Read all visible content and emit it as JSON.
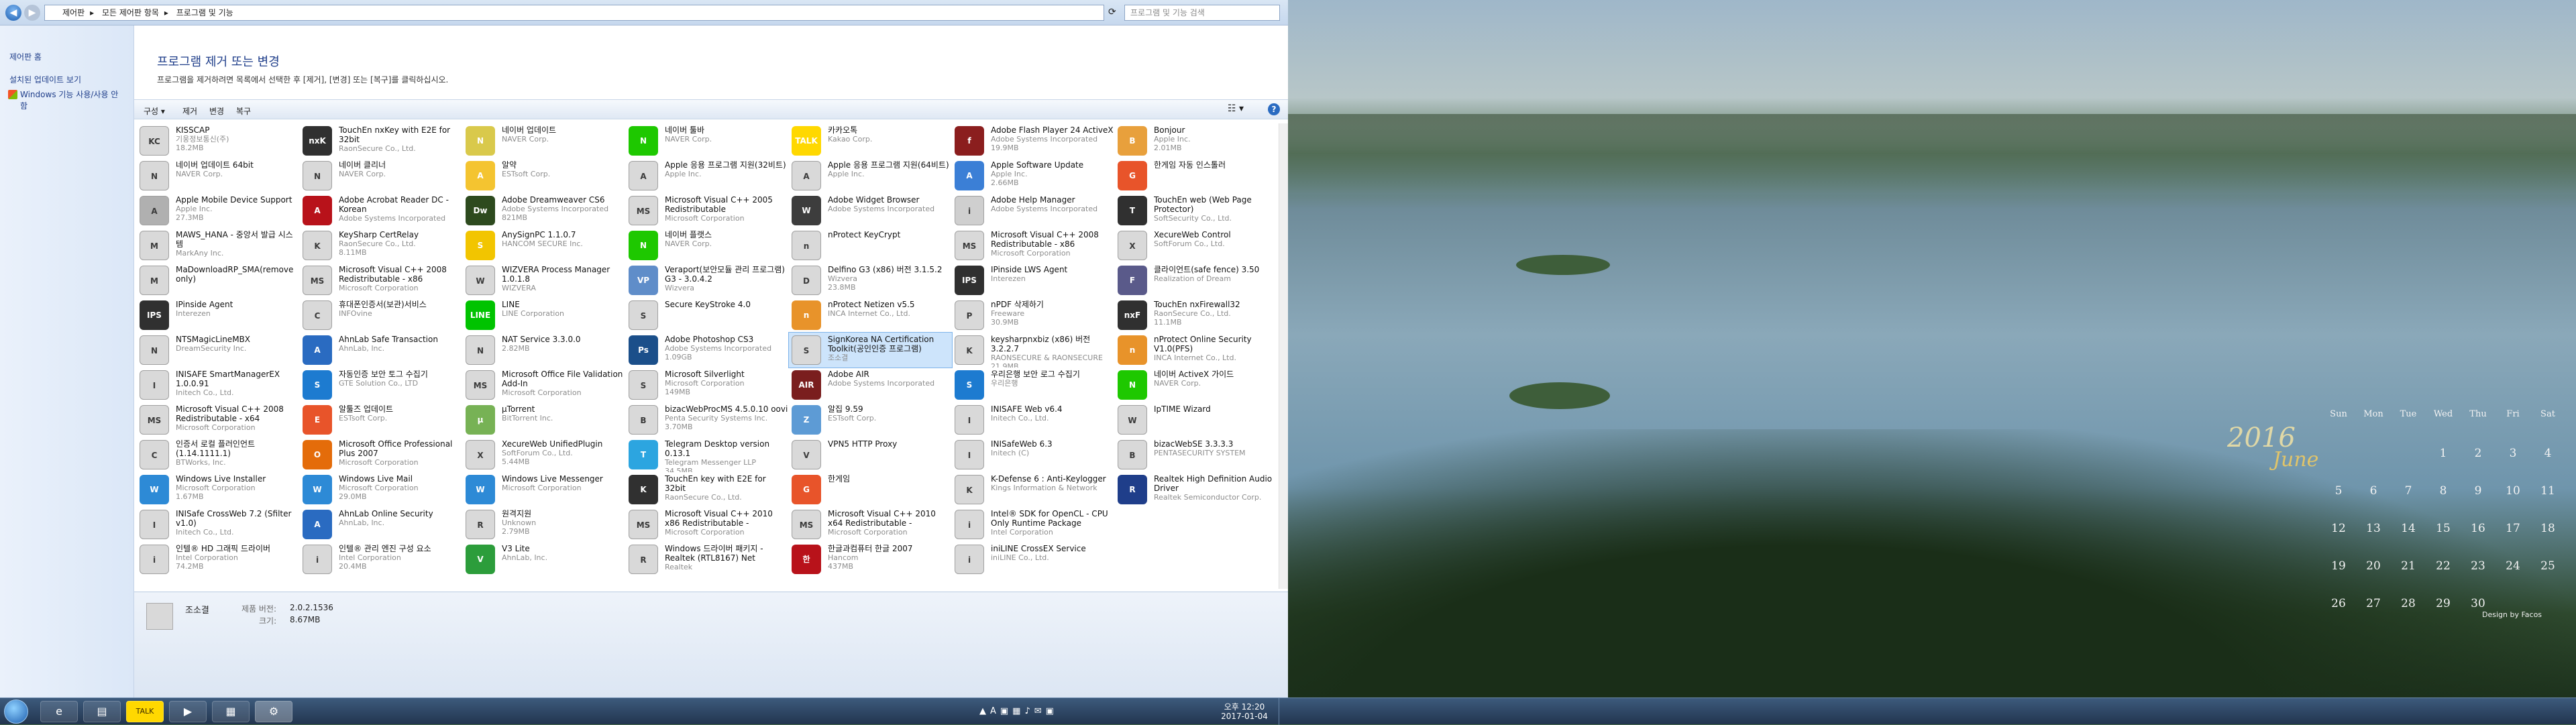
{
  "window": {
    "breadcrumb": [
      "제어판",
      "모든 제어판 항목",
      "프로그램 및 기능"
    ],
    "search_placeholder": "프로그램 및 기능 검색"
  },
  "sidebar": {
    "links": [
      "제어판 홈",
      "설치된 업데이트 보기",
      "Windows 기능 사용/사용 안 함"
    ]
  },
  "main": {
    "title": "프로그램 제거 또는 변경",
    "description": "프로그램을 제거하려면 목록에서 선택한 후 [제거], [변경] 또는 [복구]를 클릭하십시오."
  },
  "toolbar": {
    "organize": "구성 ▾",
    "uninstall": "제거",
    "change": "변경",
    "repair": "복구"
  },
  "programs": [
    {
      "name": "KISSCAP",
      "publisher": "기웅정보통신(주)",
      "size": "18.2MB",
      "color": "#d9d9d9",
      "icon": "KC"
    },
    {
      "name": "네이버 업데이트 64bit",
      "publisher": "NAVER Corp.",
      "size": "",
      "color": "#d9d9d9",
      "icon": "N"
    },
    {
      "name": "Apple Mobile Device Support",
      "publisher": "Apple Inc.",
      "size": "27.3MB",
      "color": "#b0b0b0",
      "icon": "A"
    },
    {
      "name": "MAWS_HANA - 중앙서 발급 시스템",
      "publisher": "MarkAny Inc.",
      "size": "",
      "color": "#d9d9d9",
      "icon": "M"
    },
    {
      "name": "MaDownloadRP_SMA(remove only)",
      "publisher": "",
      "size": "",
      "color": "#d9d9d9",
      "icon": "M"
    },
    {
      "name": "IPinside Agent",
      "publisher": "Interezen",
      "size": "",
      "color": "#303030",
      "icon": "IPS"
    },
    {
      "name": "NTSMagicLineMBX",
      "publisher": "DreamSecurity Inc.",
      "size": "",
      "color": "#d9d9d9",
      "icon": "N"
    },
    {
      "name": "INISAFE SmartManagerEX 1.0.0.91",
      "publisher": "Initech Co., Ltd.",
      "size": "",
      "color": "#d9d9d9",
      "icon": "I"
    },
    {
      "name": "Microsoft Visual C++ 2008 Redistributable - x64 9.0.3072...",
      "publisher": "Microsoft Corporation",
      "size": "",
      "color": "#d9d9d9",
      "icon": "MS"
    },
    {
      "name": "인증서 로컬 플러인언트 (1.14.1111.1)",
      "publisher": "BTWorks, Inc.",
      "size": "",
      "color": "#d9d9d9",
      "icon": "C"
    },
    {
      "name": "Windows Live Installer",
      "publisher": "Microsoft Corporation",
      "size": "1.67MB",
      "color": "#2d8ad6",
      "icon": "W"
    },
    {
      "name": "INISafe CrossWeb 7.2 (Sfilter v1.0)",
      "publisher": "Initech Co., Ltd.",
      "size": "",
      "color": "#d9d9d9",
      "icon": "I"
    },
    {
      "name": "인텔® HD 그래픽 드라이버",
      "publisher": "Intel Corporation",
      "size": "74.2MB",
      "color": "#d9d9d9",
      "icon": "i"
    },
    {
      "name": "TouchEn nxKey with E2E for 32bit",
      "publisher": "RaonSecure Co., Ltd.",
      "size": "",
      "color": "#303030",
      "icon": "nxK"
    },
    {
      "name": "네이버 클리너",
      "publisher": "NAVER Corp.",
      "size": "",
      "color": "#d9d9d9",
      "icon": "N"
    },
    {
      "name": "Adobe Acrobat Reader DC - Korean",
      "publisher": "Adobe Systems Incorporated",
      "size": "",
      "color": "#b8121a",
      "icon": "A"
    },
    {
      "name": "KeySharp CertRelay",
      "publisher": "RaonSecure Co., Ltd.",
      "size": "8.11MB",
      "color": "#d9d9d9",
      "icon": "K"
    },
    {
      "name": "Microsoft Visual C++ 2008 Redistributable - x86 9.0.21022",
      "publisher": "Microsoft Corporation",
      "size": "",
      "color": "#d9d9d9",
      "icon": "MS"
    },
    {
      "name": "휴대폰인증서(보관)서비스",
      "publisher": "INFOvine",
      "size": "",
      "color": "#d9d9d9",
      "icon": "C"
    },
    {
      "name": "AhnLab Safe Transaction",
      "publisher": "AhnLab, Inc.",
      "size": "",
      "color": "#2a6bc1",
      "icon": "A"
    },
    {
      "name": "자동인증 보안 토그 수집기",
      "publisher": "GTE Solution Co., LTD",
      "size": "",
      "color": "#1d7bd0",
      "icon": "S"
    },
    {
      "name": "알툴즈 업데이트",
      "publisher": "ESTsoft Corp.",
      "size": "",
      "color": "#e8542a",
      "icon": "E"
    },
    {
      "name": "Microsoft Office Professional Plus 2007",
      "publisher": "Microsoft Corporation",
      "size": "",
      "color": "#e46c0a",
      "icon": "O"
    },
    {
      "name": "Windows Live Mail",
      "publisher": "Microsoft Corporation",
      "size": "29.0MB",
      "color": "#2d8ad6",
      "icon": "W"
    },
    {
      "name": "AhnLab Online Security",
      "publisher": "AhnLab, Inc.",
      "size": "",
      "color": "#2a6bc1",
      "icon": "A"
    },
    {
      "name": "인텔® 관리 엔진 구성 요소",
      "publisher": "Intel Corporation",
      "size": "20.4MB",
      "color": "#d9d9d9",
      "icon": "i"
    },
    {
      "name": "네이버 업데이트",
      "publisher": "NAVER Corp.",
      "size": "",
      "color": "#d9c94b",
      "icon": "N"
    },
    {
      "name": "알약",
      "publisher": "ESTsoft Corp.",
      "size": "",
      "color": "#f4c430",
      "icon": "A"
    },
    {
      "name": "Adobe Dreamweaver CS6",
      "publisher": "Adobe Systems Incorporated",
      "size": "821MB",
      "color": "#2d4a1e",
      "icon": "Dw"
    },
    {
      "name": "AnySignPC 1.1.0.7",
      "publisher": "HANCOM SECURE Inc.",
      "size": "",
      "color": "#f2c500",
      "icon": "S"
    },
    {
      "name": "WIZVERA Process Manager 1.0.1.8",
      "publisher": "WIZVERA",
      "size": "",
      "color": "#d9d9d9",
      "icon": "W"
    },
    {
      "name": "LINE",
      "publisher": "LINE Corporation",
      "size": "",
      "color": "#00c300",
      "icon": "LINE"
    },
    {
      "name": "NAT Service 3.3.0.0",
      "publisher": "",
      "size": "2.82MB",
      "color": "#d9d9d9",
      "icon": "N"
    },
    {
      "name": "Microsoft Office File Validation Add-In",
      "publisher": "Microsoft Corporation",
      "size": "",
      "color": "#d9d9d9",
      "icon": "MS"
    },
    {
      "name": "µTorrent",
      "publisher": "BitTorrent Inc.",
      "size": "",
      "color": "#77b255",
      "icon": "µ"
    },
    {
      "name": "XecureWeb UnifiedPlugin",
      "publisher": "SoftForum Co., Ltd.",
      "size": "5.44MB",
      "color": "#d9d9d9",
      "icon": "X"
    },
    {
      "name": "Windows Live Messenger",
      "publisher": "Microsoft Corporation",
      "size": "",
      "color": "#2d8ad6",
      "icon": "W"
    },
    {
      "name": "원격지원",
      "publisher": "Unknown",
      "size": "2.79MB",
      "color": "#d9d9d9",
      "icon": "R"
    },
    {
      "name": "V3 Lite",
      "publisher": "AhnLab, Inc.",
      "size": "",
      "color": "#2c9d3b",
      "icon": "V"
    },
    {
      "name": "네이버 툴바",
      "publisher": "NAVER Corp.",
      "size": "",
      "color": "#1ec800",
      "icon": "N"
    },
    {
      "name": "Apple 응용 프로그램 지원(32비트)",
      "publisher": "Apple Inc.",
      "size": "",
      "color": "#d9d9d9",
      "icon": "A"
    },
    {
      "name": "Microsoft Visual C++ 2005 Redistributable",
      "publisher": "Microsoft Corporation",
      "size": "",
      "color": "#d9d9d9",
      "icon": "MS"
    },
    {
      "name": "네이버 플랫스",
      "publisher": "NAVER Corp.",
      "size": "",
      "color": "#1ec800",
      "icon": "N"
    },
    {
      "name": "Veraport(보안모듈 관리 프로그램) G3 - 3.0.4.2",
      "publisher": "Wizvera",
      "size": "",
      "color": "#5f8dc9",
      "icon": "VP"
    },
    {
      "name": "Secure KeyStroke 4.0",
      "publisher": "",
      "size": "",
      "color": "#d9d9d9",
      "icon": "S"
    },
    {
      "name": "Adobe Photoshop CS3",
      "publisher": "Adobe Systems Incorporated",
      "size": "1.09GB",
      "color": "#1b4f8a",
      "icon": "Ps"
    },
    {
      "name": "Microsoft Silverlight",
      "publisher": "Microsoft Corporation",
      "size": "149MB",
      "color": "#d9d9d9",
      "icon": "S"
    },
    {
      "name": "bizacWebProcMS 4.5.0.10 oovi",
      "publisher": "Penta Security Systems Inc.",
      "size": "3.70MB",
      "color": "#d9d9d9",
      "icon": "B"
    },
    {
      "name": "Telegram Desktop version 0.13.1",
      "publisher": "Telegram Messenger LLP",
      "size": "34.5MB",
      "color": "#2ca5e0",
      "icon": "T"
    },
    {
      "name": "TouchEn key with E2E for 32bit",
      "publisher": "RaonSecure Co., Ltd.",
      "size": "",
      "color": "#303030",
      "icon": "K"
    },
    {
      "name": "Microsoft Visual C++ 2010 x86 Redistributable - 10.0.40219",
      "publisher": "Microsoft Corporation",
      "size": "",
      "color": "#d9d9d9",
      "icon": "MS"
    },
    {
      "name": "Windows 드라이버 패키지 - Realtek (RTL8167) Net (04/10...",
      "publisher": "Realtek",
      "size": "",
      "color": "#d9d9d9",
      "icon": "R"
    },
    {
      "name": "카카오톡",
      "publisher": "Kakao Corp.",
      "size": "",
      "color": "#ffd800",
      "icon": "TALK"
    },
    {
      "name": "Apple 응용 프로그램 지원(64비트)",
      "publisher": "Apple Inc.",
      "size": "",
      "color": "#d9d9d9",
      "icon": "A"
    },
    {
      "name": "Adobe Widget Browser",
      "publisher": "Adobe Systems Incorporated",
      "size": "",
      "color": "#3d3d3d",
      "icon": "W"
    },
    {
      "name": "nProtect KeyCrypt",
      "publisher": "",
      "size": "",
      "color": "#d9d9d9",
      "icon": "n"
    },
    {
      "name": "Delfino G3 (x86) 버전 3.1.5.2",
      "publisher": "Wizvera",
      "size": "23.8MB",
      "color": "#d9d9d9",
      "icon": "D"
    },
    {
      "name": "nProtect Netizen v5.5",
      "publisher": "INCA Internet Co., Ltd.",
      "size": "",
      "color": "#e8932a",
      "icon": "n"
    },
    {
      "name": "SignKorea NA Certification Toolkit(공인인증 프로그램)",
      "publisher": "조소결",
      "size": "",
      "color": "#d9d9d9",
      "icon": "S",
      "selected": true
    },
    {
      "name": "Adobe AIR",
      "publisher": "Adobe Systems Incorporated",
      "size": "",
      "color": "#7a1e1e",
      "icon": "AIR"
    },
    {
      "name": "알집 9.59",
      "publisher": "ESTsoft Corp.",
      "size": "",
      "color": "#5d9bd5",
      "icon": "Z"
    },
    {
      "name": "VPN5 HTTP Proxy",
      "publisher": "",
      "size": "",
      "color": "#d9d9d9",
      "icon": "V"
    },
    {
      "name": "한게임",
      "publisher": "",
      "size": "",
      "color": "#e8542a",
      "icon": "G"
    },
    {
      "name": "Microsoft Visual C++ 2010 x64 Redistributable - 10.0.40219",
      "publisher": "Microsoft Corporation",
      "size": "",
      "color": "#d9d9d9",
      "icon": "MS"
    },
    {
      "name": "한글과컴퓨터 한글 2007",
      "publisher": "Hancom",
      "size": "437MB",
      "color": "#b8121a",
      "icon": "한"
    },
    {
      "name": "Adobe Flash Player 24 ActiveX",
      "publisher": "Adobe Systems Incorporated",
      "size": "19.9MB",
      "color": "#8b1e1e",
      "icon": "f"
    },
    {
      "name": "Apple Software Update",
      "publisher": "Apple Inc.",
      "size": "2.66MB",
      "color": "#3b7fd6",
      "icon": "A"
    },
    {
      "name": "Adobe Help Manager",
      "publisher": "Adobe Systems Incorporated",
      "size": "",
      "color": "#cfcfcf",
      "icon": "i"
    },
    {
      "name": "Microsoft Visual C++ 2008 Redistributable - x86 9.0.3072...",
      "publisher": "Microsoft Corporation",
      "size": "",
      "color": "#d9d9d9",
      "icon": "MS"
    },
    {
      "name": "IPinside LWS Agent",
      "publisher": "Interezen",
      "size": "",
      "color": "#303030",
      "icon": "IPS"
    },
    {
      "name": "nPDF 삭제하기",
      "publisher": "Freeware",
      "size": "30.9MB",
      "color": "#d9d9d9",
      "icon": "P"
    },
    {
      "name": "keysharpnxbiz (x86) 버전 3.2.2.7",
      "publisher": "RAONSECURE & RAONSECURE",
      "size": "21.9MB",
      "color": "#d9d9d9",
      "icon": "K"
    },
    {
      "name": "우리은행 보안 로그 수집기",
      "publisher": "우리은행",
      "size": "",
      "color": "#1d7bd0",
      "icon": "S"
    },
    {
      "name": "INISAFE Web v6.4",
      "publisher": "Initech Co., Ltd.",
      "size": "",
      "color": "#d9d9d9",
      "icon": "I"
    },
    {
      "name": "INISafeWeb 6.3",
      "publisher": "Initech (C)",
      "size": "",
      "color": "#d9d9d9",
      "icon": "I"
    },
    {
      "name": "K-Defense 6 : Anti-Keylogger",
      "publisher": "Kings Information & Network",
      "size": "",
      "color": "#d9d9d9",
      "icon": "K"
    },
    {
      "name": "Intel® SDK for OpenCL - CPU Only Runtime Package",
      "publisher": "Intel Corporation",
      "size": "",
      "color": "#d9d9d9",
      "icon": "i"
    },
    {
      "name": "iniLINE CrossEX Service",
      "publisher": "iniLINE Co., Ltd.",
      "size": "",
      "color": "#d9d9d9",
      "icon": "i"
    },
    {
      "name": "Bonjour",
      "publisher": "Apple Inc.",
      "size": "2.01MB",
      "color": "#e8a03c",
      "icon": "B"
    },
    {
      "name": "한게임 자동 인스톨러",
      "publisher": "",
      "size": "",
      "color": "#e8542a",
      "icon": "G"
    },
    {
      "name": "TouchEn web (Web Page Protector)",
      "publisher": "SoftSecurity Co., Ltd.",
      "size": "",
      "color": "#303030",
      "icon": "T"
    },
    {
      "name": "XecureWeb Control",
      "publisher": "SoftForum Co., Ltd.",
      "size": "",
      "color": "#d9d9d9",
      "icon": "X"
    },
    {
      "name": "클라이언트(safe fence) 3.50",
      "publisher": "Realization of Dream",
      "size": "",
      "color": "#5a5a8a",
      "icon": "F"
    },
    {
      "name": "TouchEn nxFirewall32",
      "publisher": "RaonSecure Co., Ltd.",
      "size": "11.1MB",
      "color": "#303030",
      "icon": "nxF"
    },
    {
      "name": "nProtect Online Security V1.0(PFS)",
      "publisher": "INCA Internet Co., Ltd.",
      "size": "",
      "color": "#e8932a",
      "icon": "n"
    },
    {
      "name": "네이버 ActiveX 가이드",
      "publisher": "NAVER Corp.",
      "size": "",
      "color": "#1ec800",
      "icon": "N"
    },
    {
      "name": "IpTIME Wizard",
      "publisher": "",
      "size": "",
      "color": "#d9d9d9",
      "icon": "W"
    },
    {
      "name": "bizacWebSE 3.3.3.3",
      "publisher": "PENTASECURITY SYSTEM",
      "size": "",
      "color": "#d9d9d9",
      "icon": "B"
    },
    {
      "name": "Realtek High Definition Audio Driver",
      "publisher": "Realtek Semiconductor Corp.",
      "size": "",
      "color": "#1f3e8a",
      "icon": "R"
    }
  ],
  "details": {
    "name": "조소결",
    "version_label": "제품 버전:",
    "version": "2.0.2.1536",
    "size_label": "크기:",
    "size": "8.67MB"
  },
  "taskbar": {
    "time": "오후 12:20",
    "date": "2017-01-04"
  },
  "calendar": {
    "year": "2016",
    "month": "June",
    "days_header": [
      "Sun",
      "Mon",
      "Tue",
      "Wed",
      "Thu",
      "Fri",
      "Sat"
    ],
    "days": [
      "",
      "",
      "",
      "1",
      "2",
      "3",
      "4",
      "5",
      "6",
      "7",
      "8",
      "9",
      "10",
      "11",
      "12",
      "13",
      "14",
      "15",
      "16",
      "17",
      "18",
      "19",
      "20",
      "21",
      "22",
      "23",
      "24",
      "25",
      "26",
      "27",
      "28",
      "29",
      "30"
    ],
    "credit": "Design by Facos"
  }
}
